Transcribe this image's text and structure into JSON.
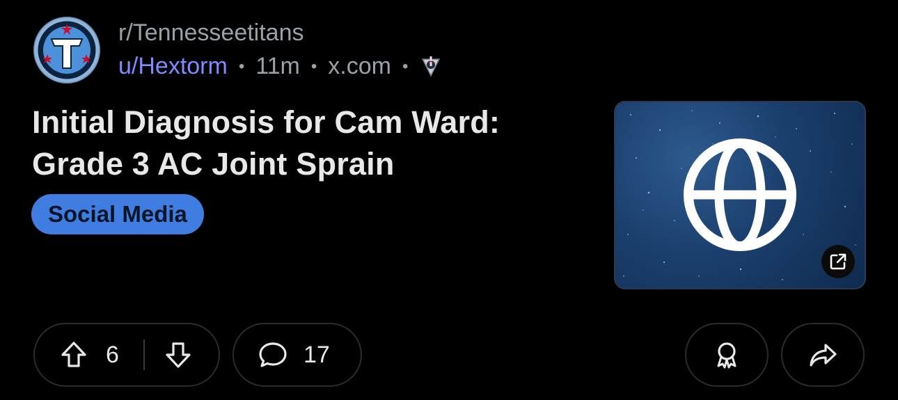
{
  "post": {
    "subreddit": "r/Tennesseetitans",
    "author": "u/Hextorm",
    "age": "11m",
    "domain": "x.com",
    "separator": "•",
    "title": "Initial Diagnosis for Cam Ward: Grade 3 AC Joint Sprain",
    "flair": "Social Media"
  },
  "actions": {
    "upvotes": "6",
    "comments": "17"
  },
  "icons": {
    "avatar": "titans-logo-icon",
    "flair": "titans-sword-icon",
    "link": "globe-icon",
    "external": "external-link-icon",
    "upvote": "arrow-up-icon",
    "downvote": "arrow-down-icon",
    "comment": "speech-bubble-icon",
    "award": "award-ribbon-icon",
    "share": "share-arrow-icon"
  },
  "colors": {
    "background": "#000000",
    "author": "#7f8cff",
    "flair_bg": "#3f7de0",
    "muted": "#9aa1a8"
  }
}
